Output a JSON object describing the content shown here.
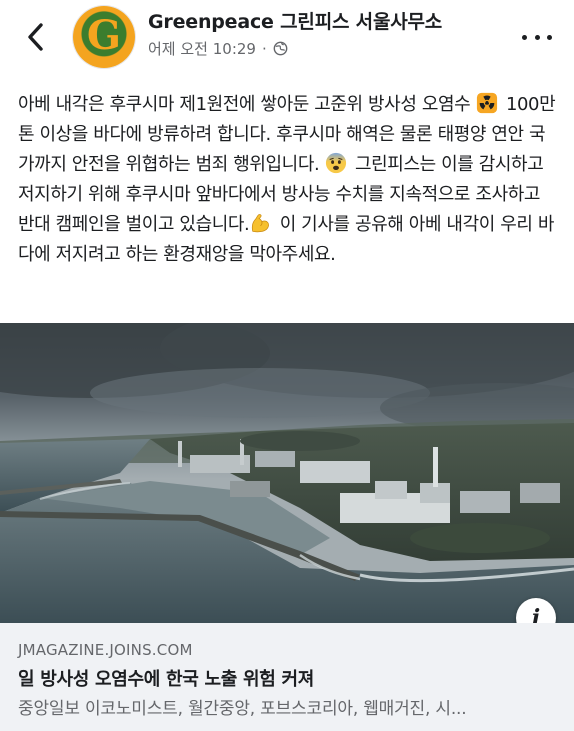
{
  "header": {
    "page_name": "Greenpeace 그린피스 서울사무소",
    "timestamp": "어제 오전 10:29",
    "separator": "·",
    "avatar_letter": "G",
    "privacy_icon": "globe-icon",
    "back_icon": "chevron-left-icon",
    "more_icon": "more-horizontal-icon"
  },
  "post": {
    "text_1": "아베 내각은 후쿠시마 제1원전에 쌓아둔 고준위 방사성 오염수 ",
    "emoji_1": "radioactive-emoji",
    "text_2": " 100만 톤 이상을 바다에 방류하려 합니다. 후쿠시마 해역은 물론 태평양 연안 국가까지 안전을 위협하는 범죄 행위입니다. ",
    "emoji_2": "fearful-face-emoji",
    "text_3": " 그린피스는 이를 감시하고 저지하기 위해 후쿠시마 앞바다에서 방사능 수치를 지속적으로 조사하고 반대 캠페인을 벌이고 있습니다.",
    "emoji_3": "flexed-biceps-emoji",
    "text_4": " 이 기사를 공유해 아베 내각이 우리 바다에 저지려고 하는 환경재앙을 막아주세요."
  },
  "link_preview": {
    "image_subject": "coastal nuclear power plant under stormy sky",
    "info_icon": "info-icon",
    "info_label": "i",
    "domain": "JMAGAZINE.JOINS.COM",
    "title": "일 방사성 오염수에 한국 노출 위험 커져",
    "description": "중앙일보 이코노미스트, 월간중앙, 포브스코리아, 웹매거진, 시..."
  },
  "colors": {
    "text_primary": "#1c1e21",
    "text_secondary": "#65676b",
    "link_box_bg": "#f0f2f5",
    "brand_orange": "#f4a41f",
    "brand_green": "#3b7d2e"
  }
}
